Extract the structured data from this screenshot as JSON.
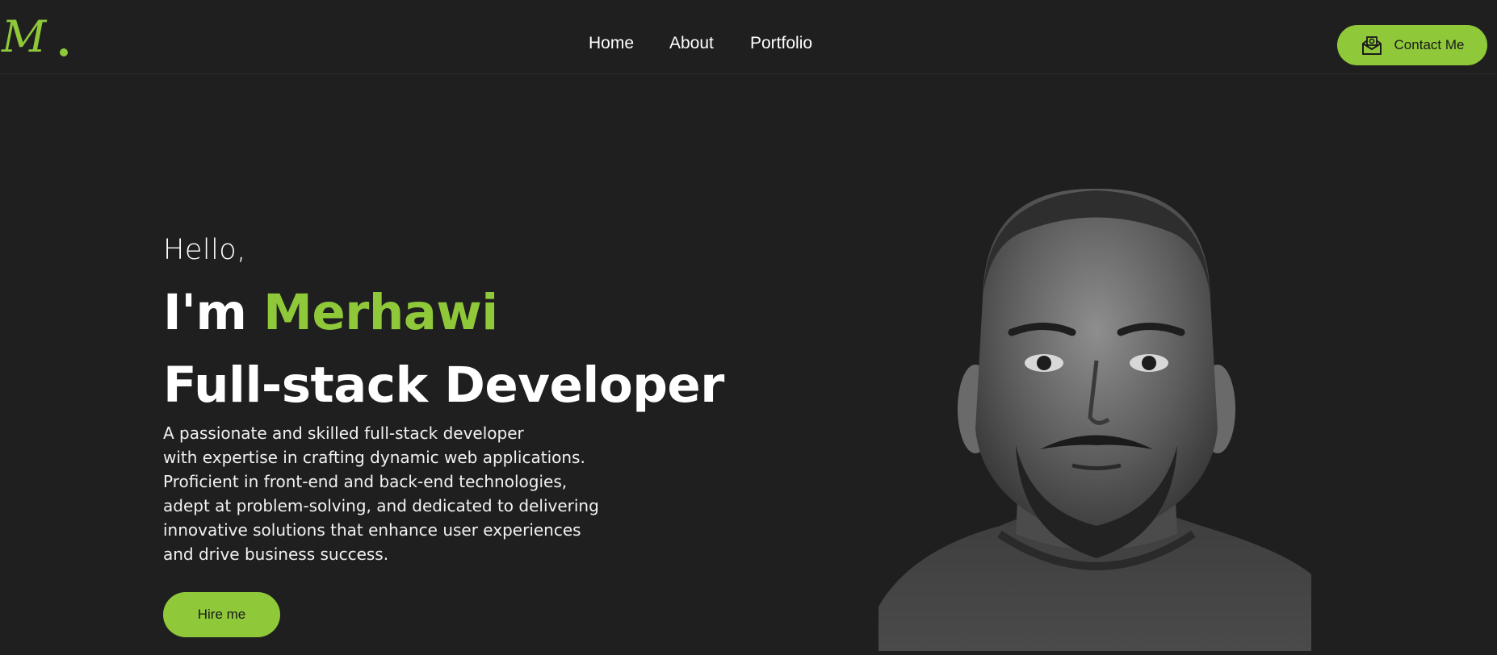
{
  "brand": {
    "logo_text": "M"
  },
  "nav": {
    "items": [
      {
        "label": "Home"
      },
      {
        "label": "About"
      },
      {
        "label": "Portfolio"
      }
    ],
    "contact_label": "Contact Me",
    "contact_icon": "mail-open-icon"
  },
  "hero": {
    "greeting": "Hello,",
    "intro_prefix": "I'm ",
    "name": "Merhawi",
    "role": "Full-stack Developer",
    "bio_lines": [
      "A passionate and skilled full-stack developer",
      "with expertise in crafting dynamic web applications.",
      "Proficient in front-end and back-end technologies,",
      "adept at problem-solving, and dedicated to delivering",
      "innovative solutions that enhance user experiences",
      "and drive business success."
    ],
    "cta_label": "Hire me"
  },
  "colors": {
    "background": "#1f1f1f",
    "accent": "#8fc93a",
    "text": "#ffffff"
  }
}
